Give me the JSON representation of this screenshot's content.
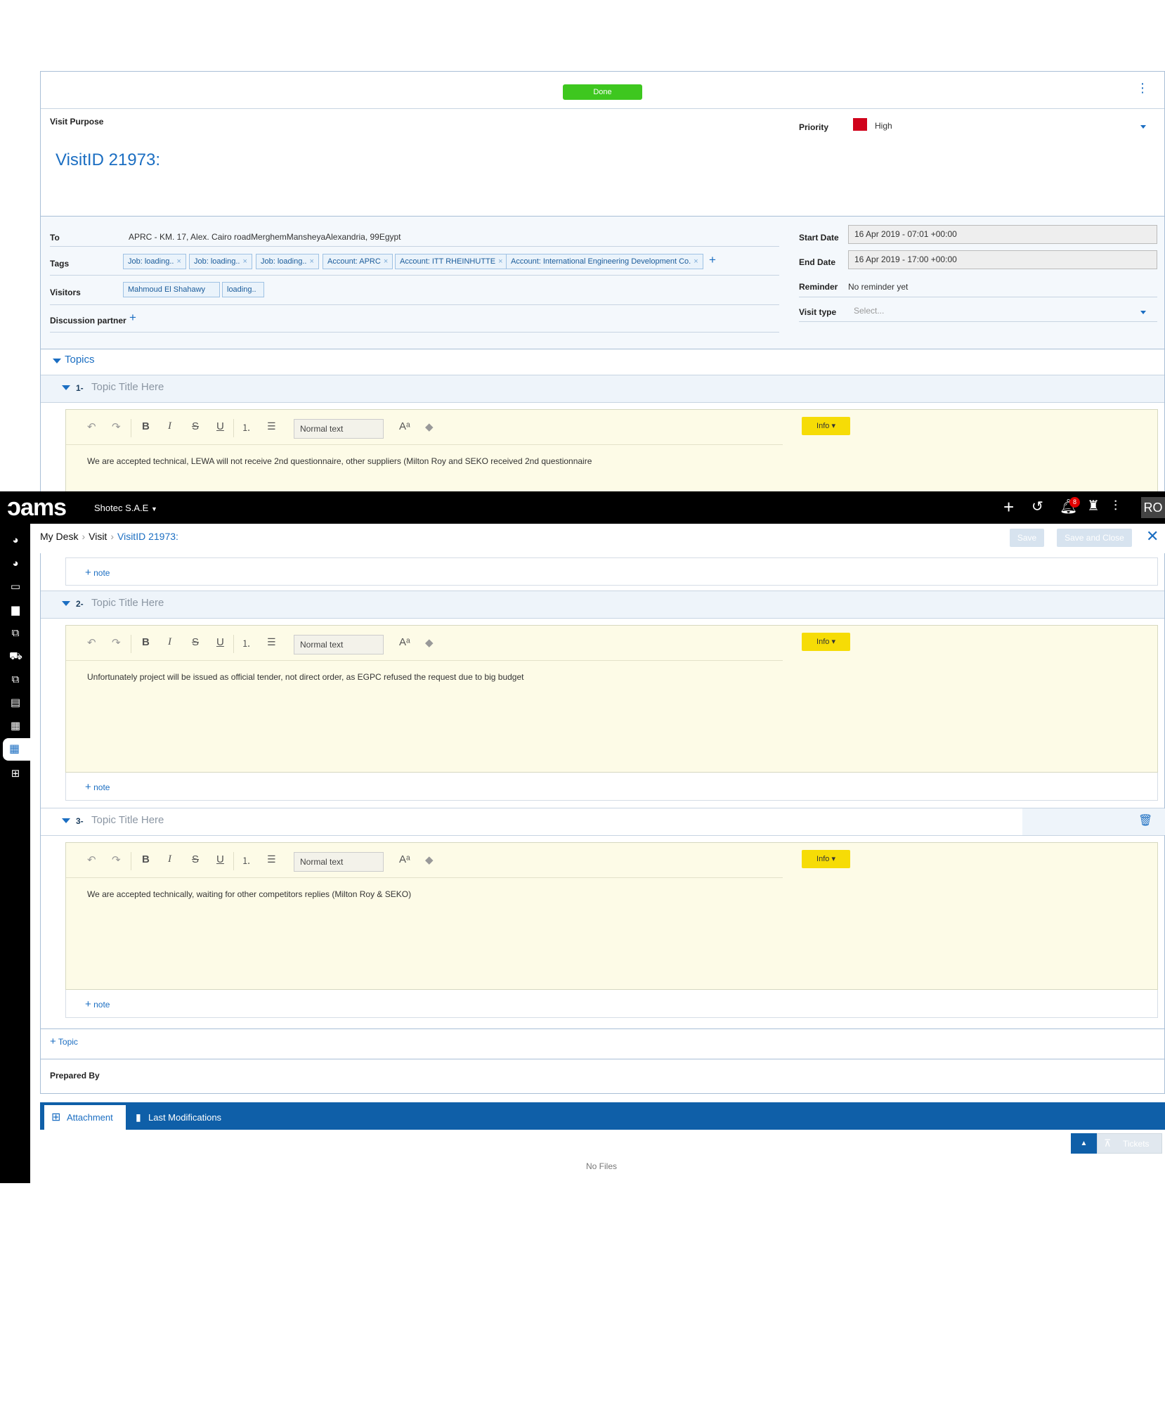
{
  "header": {
    "done_label": "Done",
    "more_icon": "kebab-vertical-icon",
    "visit_purpose_label": "Visit Purpose",
    "title": "VisitID 21973:",
    "priority_label": "Priority",
    "priority_value": "High",
    "priority_color": "#d0021b"
  },
  "details": {
    "to_label": "To",
    "to_value": "APRC - KM. 17, Alex. Cairo roadMerghemMansheyaAlexandria,  99Egypt",
    "tags_label": "Tags",
    "tags": [
      "Job: loading..",
      "Job: loading..",
      "Job: loading..",
      "Account: APRC",
      "Account: ITT RHEINHUTTE",
      "Account: International Engineering Development Co."
    ],
    "visitors_label": "Visitors",
    "visitors": [
      "Mahmoud El Shahawy",
      "loading.."
    ],
    "discussion_label": "Discussion partner",
    "start_label": "Start Date",
    "start_value": "16 Apr 2019 - 07:01 +00:00",
    "end_label": "End Date",
    "end_value": "16 Apr 2019 - 17:00 +00:00",
    "reminder_label": "Reminder",
    "reminder_value": "No reminder yet",
    "visit_type_label": "Visit type",
    "visit_type_placeholder": "Select..."
  },
  "topics": {
    "section_label": "Topics",
    "items": [
      {
        "number": "1-",
        "title_placeholder": "Topic Title Here",
        "format": "Normal text",
        "info_label": "Info",
        "text": "We are accepted technical, LEWA will not receive 2nd questionnaire, other suppliers (Milton Roy and SEKO received 2nd questionnaire"
      },
      {
        "number": "2-",
        "title_placeholder": "Topic Title Here",
        "format": "Normal text",
        "info_label": "Info",
        "text": "Unfortunately project will be issued as official tender, not direct order, as EGPC refused the request due to big budget"
      },
      {
        "number": "3-",
        "title_placeholder": "Topic Title Here",
        "format": "Normal text",
        "info_label": "Info",
        "text": "We are accepted technically, waiting for other competitors replies (Milton Roy & SEKO)"
      }
    ],
    "note_label": "note",
    "add_topic_label": "Topic"
  },
  "prepared_by_label": "Prepared By",
  "nav": {
    "logo": "ams",
    "company": "Shotec S.A.E",
    "notif_count": "8",
    "avatar": "RO"
  },
  "breadcrumb": {
    "home": "My Desk",
    "section": "Visit",
    "current": "VisitID 21973:"
  },
  "actions": {
    "save": "Save",
    "save_close": "Save and Close"
  },
  "bottom_tabs": {
    "attachment": "Attachment",
    "last_mod": "Last Modifications",
    "empty": "No Files",
    "tickets": "Tickets"
  },
  "colors": {
    "accent": "#1b6ec2",
    "done": "#3ec71f",
    "info": "#f6dc06",
    "editor_bg": "#fdfbe7",
    "bar": "#0f5fa8"
  }
}
